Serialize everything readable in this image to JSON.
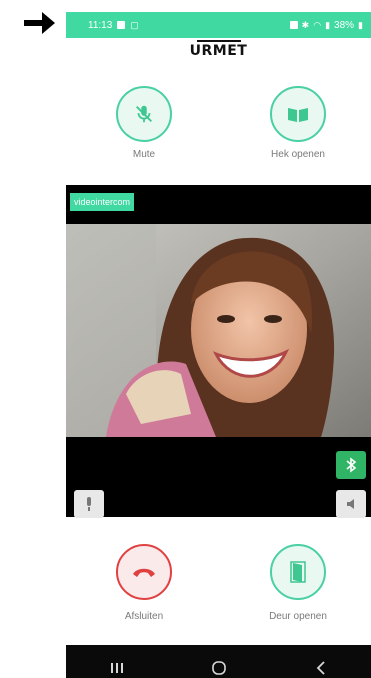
{
  "status_bar": {
    "time": "11:13",
    "battery": "38%"
  },
  "header": {
    "logo": "URMET"
  },
  "top_buttons": [
    {
      "label": "Mute",
      "icon": "microphone-off-icon"
    },
    {
      "label": "Hek openen",
      "icon": "gate-icon"
    }
  ],
  "video": {
    "source_label": "videointercom",
    "side_buttons": [
      "bluetooth-icon",
      "microphone-icon",
      "speaker-icon"
    ]
  },
  "bottom_buttons": [
    {
      "label": "Afsluiten",
      "icon": "hangup-icon"
    },
    {
      "label": "Deur openen",
      "icon": "door-icon"
    }
  ],
  "navigation": {
    "items": [
      "recent-apps-icon",
      "home-icon",
      "back-icon"
    ]
  },
  "colors": {
    "accent": "#3fd9a1",
    "hangup": "#e04040",
    "video_bg": "#000000"
  }
}
